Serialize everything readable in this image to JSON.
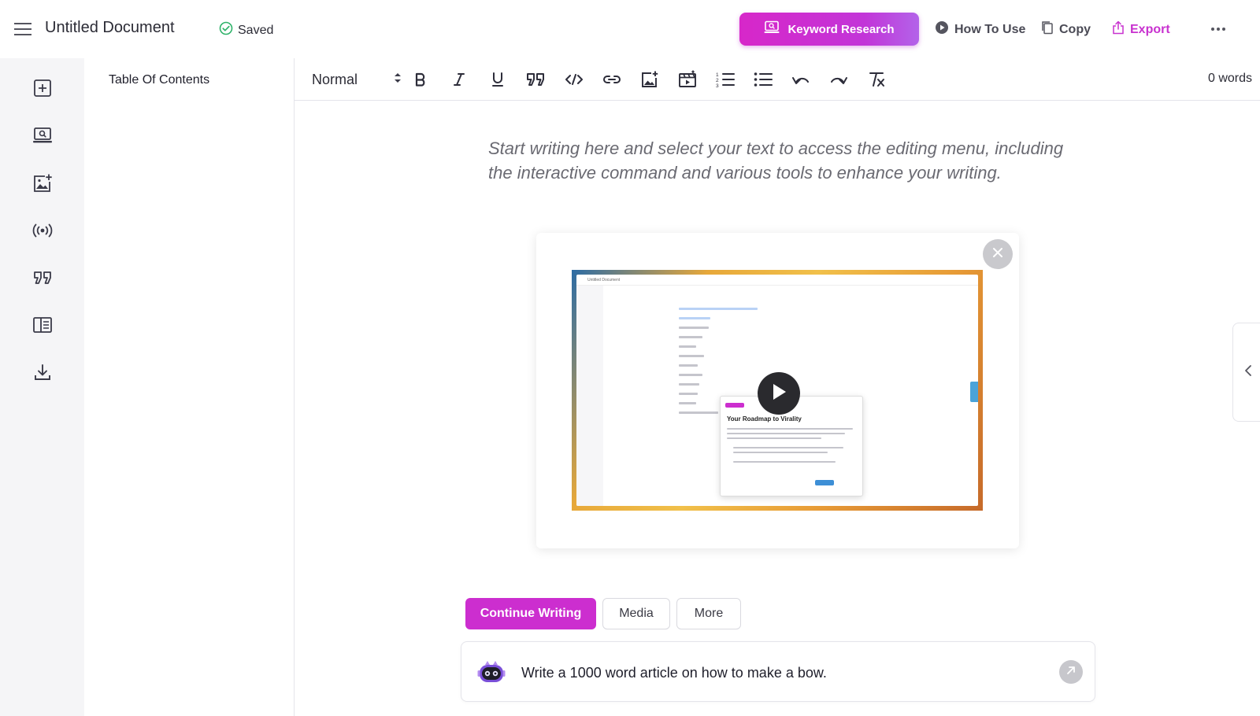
{
  "header": {
    "title": "Untitled Document",
    "saved_label": "Saved",
    "keyword_research_label": "Keyword Research",
    "how_to_use_label": "How To Use",
    "copy_label": "Copy",
    "export_label": "Export"
  },
  "sidebar": {
    "icons": [
      "add-block-icon",
      "keyword-research-icon",
      "add-image-icon",
      "broadcast-icon",
      "quote-icon",
      "panel-layout-icon",
      "download-icon"
    ]
  },
  "toc": {
    "title": "Table Of Contents"
  },
  "toolbar": {
    "style_value": "Normal",
    "word_count": "0 words"
  },
  "editor": {
    "placeholder": "Start writing here and select your text to access the editing menu, including the interactive command and various tools to enhance your writing."
  },
  "video": {
    "thumb_title": "Untitled Document",
    "thumb_popup_title": "Your Roadmap to Virality"
  },
  "actions": {
    "continue_label": "Continue Writing",
    "media_label": "Media",
    "more_label": "More"
  },
  "prompt": {
    "value": "Write a 1000 word article on how to make a bow."
  },
  "colors": {
    "accent": "#cc2ecf",
    "saved_check": "#2fb36a"
  }
}
